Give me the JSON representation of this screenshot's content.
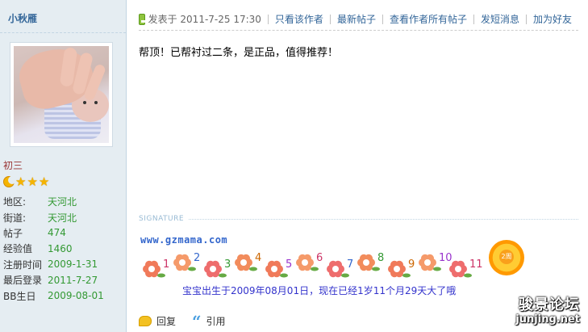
{
  "author": {
    "name": "小秋雁",
    "rank_title": "初三",
    "stats": [
      {
        "label": "地区:",
        "value": "天河北"
      },
      {
        "label": "街道:",
        "value": "天河北"
      },
      {
        "label": "帖子",
        "value": "474"
      },
      {
        "label": "经验值",
        "value": "1460"
      },
      {
        "label": "注册时间",
        "value": "2009-1-31"
      },
      {
        "label": "最后登录",
        "value": "2011-7-27"
      },
      {
        "label": "BB生日",
        "value": "2009-08-01"
      }
    ]
  },
  "post": {
    "posted_at": "发表于 2011-7-25 17:30",
    "actions": [
      "只看该作者",
      "最新帖子",
      "查看作者所有帖子",
      "发短消息",
      "加为好友"
    ],
    "body": "帮顶！已帮衬过二条，是正品，值得推荐！"
  },
  "signature": {
    "label": "SIGNATURE",
    "url": "www.gzmama.com",
    "numbers": [
      "1",
      "2",
      "3",
      "4",
      "5",
      "6",
      "7",
      "8",
      "9",
      "10",
      "11"
    ],
    "caption": "宝宝出生于2009年08月01日，现在已经1岁11个月29天大了哦",
    "badge": "2周"
  },
  "footer": {
    "reply": "回复",
    "quote": "引用"
  },
  "watermark": {
    "cn": "骏景论坛",
    "en": "junjing.net"
  },
  "colors": {
    "sidebar_bg": "#e5edf2",
    "link": "#336699",
    "stat_value": "#339933",
    "rank": "#993333"
  }
}
